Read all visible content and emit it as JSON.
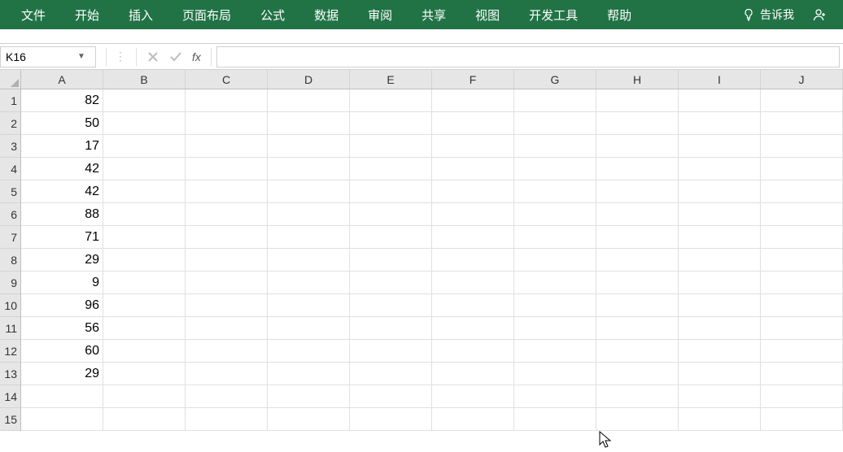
{
  "ribbon": {
    "tabs": [
      "文件",
      "开始",
      "插入",
      "页面布局",
      "公式",
      "数据",
      "审阅",
      "共享",
      "视图",
      "开发工具",
      "帮助"
    ],
    "tell_me": "告诉我"
  },
  "namebox": {
    "value": "K16",
    "placeholder": ""
  },
  "formula_bar": {
    "fx_label": "fx",
    "value": ""
  },
  "columns": [
    "A",
    "B",
    "C",
    "D",
    "E",
    "F",
    "G",
    "H",
    "I",
    "J"
  ],
  "rows": [
    "1",
    "2",
    "3",
    "4",
    "5",
    "6",
    "7",
    "8",
    "9",
    "10",
    "11",
    "12",
    "13",
    "14",
    "15"
  ],
  "cells": {
    "A1": "82",
    "A2": "50",
    "A3": "17",
    "A4": "42",
    "A5": "42",
    "A6": "88",
    "A7": "71",
    "A8": "29",
    "A9": "9",
    "A10": "96",
    "A11": "56",
    "A12": "60",
    "A13": "29",
    "A14": "",
    "A15": ""
  },
  "icons": {
    "bulb": "bulb-icon",
    "share_user": "share-user-icon",
    "cancel": "cancel-icon",
    "confirm": "confirm-icon"
  }
}
